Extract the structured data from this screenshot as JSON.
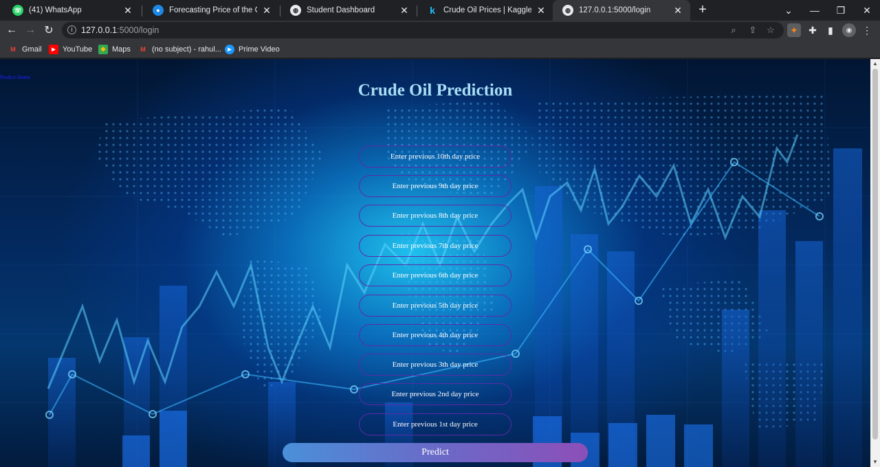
{
  "tabs": [
    {
      "title": "(41) WhatsApp",
      "favicon": "whatsapp-icon"
    },
    {
      "title": "Forecasting Price of the Crude oi",
      "favicon": "app-icon"
    },
    {
      "title": "Student Dashboard",
      "favicon": "globe-icon"
    },
    {
      "title": "Crude Oil Prices | Kaggle",
      "favicon": "kaggle-icon"
    },
    {
      "title": "127.0.0.1:5000/login",
      "favicon": "globe-icon",
      "active": true
    }
  ],
  "address_bar": {
    "host": "127.0.0.1",
    "path": ":5000/login"
  },
  "bookmarks": [
    {
      "label": "Gmail"
    },
    {
      "label": "YouTube"
    },
    {
      "label": "Maps"
    },
    {
      "label": "(no subject) - rahul..."
    },
    {
      "label": "Prime Video"
    }
  ],
  "page": {
    "nav": {
      "predict": "Predict",
      "home": "Home"
    },
    "title": "Crude Oil Prediction",
    "fields": [
      "Enter previous 10th day price",
      "Enter previous 9th day price",
      "Enter previous 8th day price",
      "Enter previous 7th day price",
      "Enter previous 6th day price",
      "Enter previous 5th day price",
      "Enter previous 4th day price",
      "Enter previous 3th day price",
      "Enter previous 2nd day price",
      "Enter previous 1st day price"
    ],
    "predict_label": "Predict"
  },
  "colors": {
    "title": "#a8def5",
    "accent_start": "#4a90d9",
    "accent_end": "#8c4fb8",
    "field_border": "#5b2aa8"
  }
}
